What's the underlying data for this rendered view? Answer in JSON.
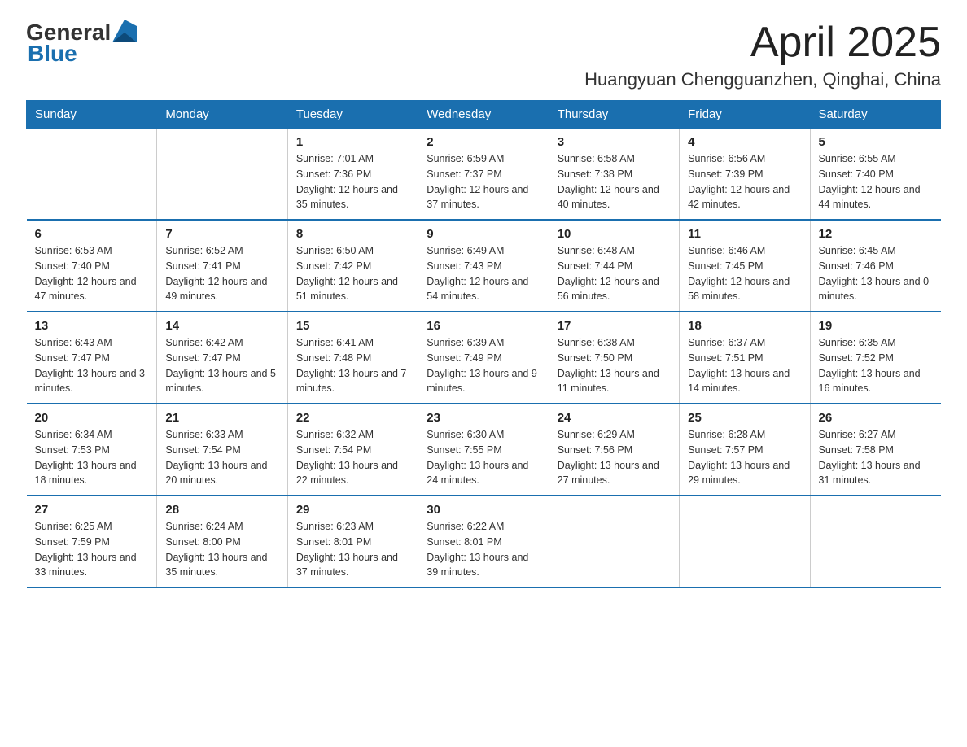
{
  "header": {
    "logo_general": "General",
    "logo_blue": "Blue",
    "month": "April 2025",
    "location": "Huangyuan Chengguanzhen, Qinghai, China"
  },
  "days_of_week": [
    "Sunday",
    "Monday",
    "Tuesday",
    "Wednesday",
    "Thursday",
    "Friday",
    "Saturday"
  ],
  "weeks": [
    [
      {
        "day": "",
        "sunrise": "",
        "sunset": "",
        "daylight": ""
      },
      {
        "day": "",
        "sunrise": "",
        "sunset": "",
        "daylight": ""
      },
      {
        "day": "1",
        "sunrise": "Sunrise: 7:01 AM",
        "sunset": "Sunset: 7:36 PM",
        "daylight": "Daylight: 12 hours and 35 minutes."
      },
      {
        "day": "2",
        "sunrise": "Sunrise: 6:59 AM",
        "sunset": "Sunset: 7:37 PM",
        "daylight": "Daylight: 12 hours and 37 minutes."
      },
      {
        "day": "3",
        "sunrise": "Sunrise: 6:58 AM",
        "sunset": "Sunset: 7:38 PM",
        "daylight": "Daylight: 12 hours and 40 minutes."
      },
      {
        "day": "4",
        "sunrise": "Sunrise: 6:56 AM",
        "sunset": "Sunset: 7:39 PM",
        "daylight": "Daylight: 12 hours and 42 minutes."
      },
      {
        "day": "5",
        "sunrise": "Sunrise: 6:55 AM",
        "sunset": "Sunset: 7:40 PM",
        "daylight": "Daylight: 12 hours and 44 minutes."
      }
    ],
    [
      {
        "day": "6",
        "sunrise": "Sunrise: 6:53 AM",
        "sunset": "Sunset: 7:40 PM",
        "daylight": "Daylight: 12 hours and 47 minutes."
      },
      {
        "day": "7",
        "sunrise": "Sunrise: 6:52 AM",
        "sunset": "Sunset: 7:41 PM",
        "daylight": "Daylight: 12 hours and 49 minutes."
      },
      {
        "day": "8",
        "sunrise": "Sunrise: 6:50 AM",
        "sunset": "Sunset: 7:42 PM",
        "daylight": "Daylight: 12 hours and 51 minutes."
      },
      {
        "day": "9",
        "sunrise": "Sunrise: 6:49 AM",
        "sunset": "Sunset: 7:43 PM",
        "daylight": "Daylight: 12 hours and 54 minutes."
      },
      {
        "day": "10",
        "sunrise": "Sunrise: 6:48 AM",
        "sunset": "Sunset: 7:44 PM",
        "daylight": "Daylight: 12 hours and 56 minutes."
      },
      {
        "day": "11",
        "sunrise": "Sunrise: 6:46 AM",
        "sunset": "Sunset: 7:45 PM",
        "daylight": "Daylight: 12 hours and 58 minutes."
      },
      {
        "day": "12",
        "sunrise": "Sunrise: 6:45 AM",
        "sunset": "Sunset: 7:46 PM",
        "daylight": "Daylight: 13 hours and 0 minutes."
      }
    ],
    [
      {
        "day": "13",
        "sunrise": "Sunrise: 6:43 AM",
        "sunset": "Sunset: 7:47 PM",
        "daylight": "Daylight: 13 hours and 3 minutes."
      },
      {
        "day": "14",
        "sunrise": "Sunrise: 6:42 AM",
        "sunset": "Sunset: 7:47 PM",
        "daylight": "Daylight: 13 hours and 5 minutes."
      },
      {
        "day": "15",
        "sunrise": "Sunrise: 6:41 AM",
        "sunset": "Sunset: 7:48 PM",
        "daylight": "Daylight: 13 hours and 7 minutes."
      },
      {
        "day": "16",
        "sunrise": "Sunrise: 6:39 AM",
        "sunset": "Sunset: 7:49 PM",
        "daylight": "Daylight: 13 hours and 9 minutes."
      },
      {
        "day": "17",
        "sunrise": "Sunrise: 6:38 AM",
        "sunset": "Sunset: 7:50 PM",
        "daylight": "Daylight: 13 hours and 11 minutes."
      },
      {
        "day": "18",
        "sunrise": "Sunrise: 6:37 AM",
        "sunset": "Sunset: 7:51 PM",
        "daylight": "Daylight: 13 hours and 14 minutes."
      },
      {
        "day": "19",
        "sunrise": "Sunrise: 6:35 AM",
        "sunset": "Sunset: 7:52 PM",
        "daylight": "Daylight: 13 hours and 16 minutes."
      }
    ],
    [
      {
        "day": "20",
        "sunrise": "Sunrise: 6:34 AM",
        "sunset": "Sunset: 7:53 PM",
        "daylight": "Daylight: 13 hours and 18 minutes."
      },
      {
        "day": "21",
        "sunrise": "Sunrise: 6:33 AM",
        "sunset": "Sunset: 7:54 PM",
        "daylight": "Daylight: 13 hours and 20 minutes."
      },
      {
        "day": "22",
        "sunrise": "Sunrise: 6:32 AM",
        "sunset": "Sunset: 7:54 PM",
        "daylight": "Daylight: 13 hours and 22 minutes."
      },
      {
        "day": "23",
        "sunrise": "Sunrise: 6:30 AM",
        "sunset": "Sunset: 7:55 PM",
        "daylight": "Daylight: 13 hours and 24 minutes."
      },
      {
        "day": "24",
        "sunrise": "Sunrise: 6:29 AM",
        "sunset": "Sunset: 7:56 PM",
        "daylight": "Daylight: 13 hours and 27 minutes."
      },
      {
        "day": "25",
        "sunrise": "Sunrise: 6:28 AM",
        "sunset": "Sunset: 7:57 PM",
        "daylight": "Daylight: 13 hours and 29 minutes."
      },
      {
        "day": "26",
        "sunrise": "Sunrise: 6:27 AM",
        "sunset": "Sunset: 7:58 PM",
        "daylight": "Daylight: 13 hours and 31 minutes."
      }
    ],
    [
      {
        "day": "27",
        "sunrise": "Sunrise: 6:25 AM",
        "sunset": "Sunset: 7:59 PM",
        "daylight": "Daylight: 13 hours and 33 minutes."
      },
      {
        "day": "28",
        "sunrise": "Sunrise: 6:24 AM",
        "sunset": "Sunset: 8:00 PM",
        "daylight": "Daylight: 13 hours and 35 minutes."
      },
      {
        "day": "29",
        "sunrise": "Sunrise: 6:23 AM",
        "sunset": "Sunset: 8:01 PM",
        "daylight": "Daylight: 13 hours and 37 minutes."
      },
      {
        "day": "30",
        "sunrise": "Sunrise: 6:22 AM",
        "sunset": "Sunset: 8:01 PM",
        "daylight": "Daylight: 13 hours and 39 minutes."
      },
      {
        "day": "",
        "sunrise": "",
        "sunset": "",
        "daylight": ""
      },
      {
        "day": "",
        "sunrise": "",
        "sunset": "",
        "daylight": ""
      },
      {
        "day": "",
        "sunrise": "",
        "sunset": "",
        "daylight": ""
      }
    ]
  ]
}
